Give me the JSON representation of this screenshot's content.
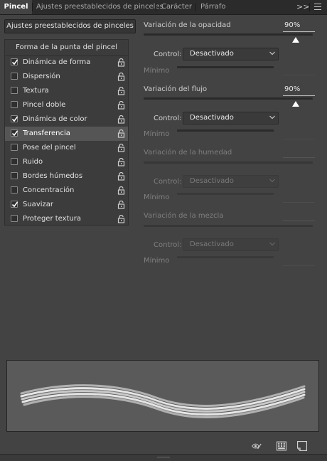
{
  "tabs": [
    {
      "label": "Pincel",
      "active": true
    },
    {
      "label": "Ajustes preestablecidos de pinceles",
      "active": false
    },
    {
      "label": "Carácter",
      "active": false
    },
    {
      "label": "Párrafo",
      "active": false
    }
  ],
  "tab_overflow_glyph": ">>",
  "presets_button": "Ajustes preestablecidos de pinceles",
  "list": {
    "heading": "Forma de la punta del pincel",
    "items": [
      {
        "label": "Dinámica de forma",
        "checked": true,
        "selected": false
      },
      {
        "label": "Dispersión",
        "checked": false,
        "selected": false
      },
      {
        "label": "Textura",
        "checked": false,
        "selected": false
      },
      {
        "label": "Pincel doble",
        "checked": false,
        "selected": false
      },
      {
        "label": "Dinámica de color",
        "checked": true,
        "selected": false
      },
      {
        "label": "Transferencia",
        "checked": true,
        "selected": true
      },
      {
        "label": "Pose del pincel",
        "checked": false,
        "selected": false
      },
      {
        "label": "Ruido",
        "checked": false,
        "selected": false
      },
      {
        "label": "Bordes húmedos",
        "checked": false,
        "selected": false
      },
      {
        "label": "Concentración",
        "checked": false,
        "selected": false
      },
      {
        "label": "Suavizar",
        "checked": true,
        "selected": false
      },
      {
        "label": "Proteger textura",
        "checked": false,
        "selected": false
      }
    ]
  },
  "opacity": {
    "label": "Variación de la opacidad",
    "value": "90%",
    "level": 0.9,
    "control_label": "Control:",
    "control_value": "Desactivado",
    "min_label": "Mínimo"
  },
  "flow": {
    "label": "Variación del flujo",
    "value": "90%",
    "level": 0.9,
    "control_label": "Control:",
    "control_value": "Desactivado",
    "min_label": "Mínimo"
  },
  "wetness": {
    "label": "Variación de la humedad",
    "control_label": "Control:",
    "control_value": "Desactivado",
    "min_label": "Mínimo"
  },
  "mix": {
    "label": "Variación de la mezcla",
    "control_label": "Control:",
    "control_value": "Desactivado",
    "min_label": "Mínimo"
  },
  "bottom_icons": [
    "eye-slash-icon",
    "grid-icon",
    "new-preset-icon"
  ],
  "colors": {
    "panel": "#434343",
    "tabbar": "#2b2b2b",
    "selected_row": "#555555"
  }
}
